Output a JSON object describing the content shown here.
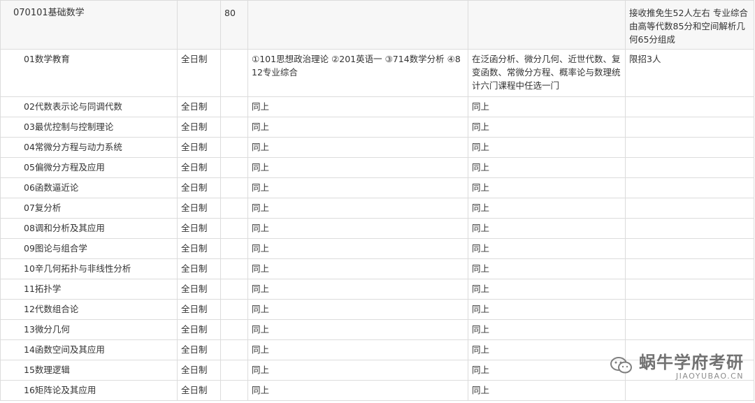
{
  "header": {
    "code_name": "070101基础数学",
    "count": "80",
    "note": "接收推免生52人左右 专业综合由高等代数85分和空间解析几何65分组成"
  },
  "first_row": {
    "direction": "01数学教育",
    "mode": "全日制",
    "exams": "①101思想政治理论 ②201英语一 ③714数学分析 ④812专业综合",
    "subjects": "在泛函分析、微分几何、近世代数、复变函数、常微分方程、概率论与数理统计六门课程中任选一门",
    "note": "限招3人"
  },
  "rows": [
    {
      "direction": "02代数表示论与同调代数",
      "mode": "全日制",
      "exams": "同上",
      "subjects": "同上"
    },
    {
      "direction": "03最优控制与控制理论",
      "mode": "全日制",
      "exams": "同上",
      "subjects": "同上"
    },
    {
      "direction": "04常微分方程与动力系统",
      "mode": "全日制",
      "exams": "同上",
      "subjects": "同上"
    },
    {
      "direction": "05偏微分方程及应用",
      "mode": "全日制",
      "exams": "同上",
      "subjects": "同上"
    },
    {
      "direction": "06函数逼近论",
      "mode": "全日制",
      "exams": "同上",
      "subjects": "同上"
    },
    {
      "direction": "07复分析",
      "mode": "全日制",
      "exams": "同上",
      "subjects": "同上"
    },
    {
      "direction": "08调和分析及其应用",
      "mode": "全日制",
      "exams": "同上",
      "subjects": "同上"
    },
    {
      "direction": "09图论与组合学",
      "mode": "全日制",
      "exams": "同上",
      "subjects": "同上"
    },
    {
      "direction": "10辛几何拓扑与非线性分析",
      "mode": "全日制",
      "exams": "同上",
      "subjects": "同上"
    },
    {
      "direction": "11拓扑学",
      "mode": "全日制",
      "exams": "同上",
      "subjects": "同上"
    },
    {
      "direction": "12代数组合论",
      "mode": "全日制",
      "exams": "同上",
      "subjects": "同上"
    },
    {
      "direction": "13微分几何",
      "mode": "全日制",
      "exams": "同上",
      "subjects": "同上"
    },
    {
      "direction": "14函数空间及其应用",
      "mode": "全日制",
      "exams": "同上",
      "subjects": "同上"
    },
    {
      "direction": "15数理逻辑",
      "mode": "全日制",
      "exams": "同上",
      "subjects": "同上"
    },
    {
      "direction": "16矩阵论及其应用",
      "mode": "全日制",
      "exams": "同上",
      "subjects": "同上"
    }
  ],
  "watermark": {
    "main": "蜗牛学府考研",
    "sub": "JIAOYUBAO.CN",
    "icon": "wechat-icon"
  }
}
